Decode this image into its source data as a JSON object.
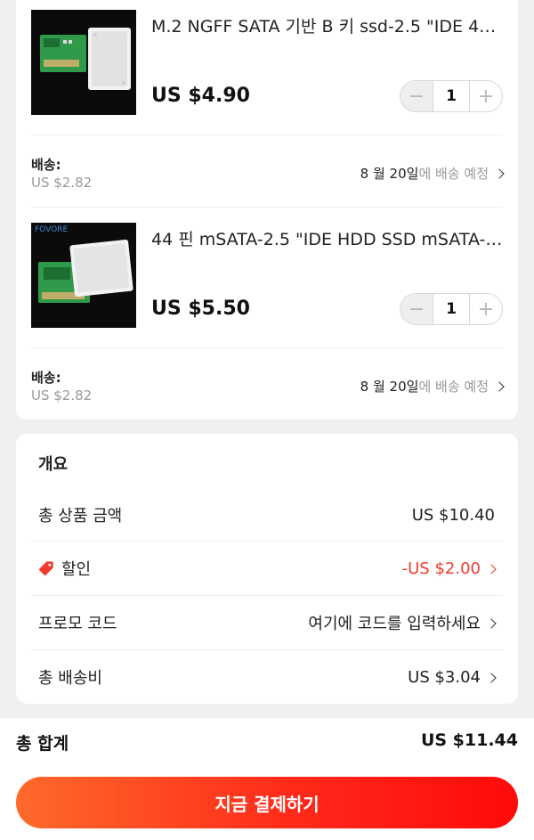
{
  "items": [
    {
      "title": "M.2 NGFF SATA 기반 B 키 ssd-2.5 \"IDE 44...",
      "price": "US $4.90",
      "quantity": "1",
      "shipping_label": "배송:",
      "shipping_cost": "US $2.82",
      "delivery_date": "8 월 20일",
      "delivery_suffix": "에 배송 예정",
      "image_brand": ""
    },
    {
      "title": "44 핀 mSATA-2.5 \"IDE HDD SSD mSATA-P...",
      "price": "US $5.50",
      "quantity": "1",
      "shipping_label": "배송:",
      "shipping_cost": "US $2.82",
      "delivery_date": "8 월 20일",
      "delivery_suffix": "에 배송 예정",
      "image_brand": "FOVORE"
    }
  ],
  "stepper": {
    "minus_icon": "minus-icon",
    "plus_icon": "plus-icon"
  },
  "summary": {
    "title": "개요",
    "rows": [
      {
        "label": "총 상품 금액",
        "value": "US $10.40"
      },
      {
        "label": "할인",
        "value": "-US $2.00",
        "icon": "tag-icon",
        "color": "#f03b2f"
      },
      {
        "label": "프로모 코드",
        "value": "여기에 코드를 입력하세요"
      },
      {
        "label": "총 배송비",
        "value": "US $3.04"
      }
    ]
  },
  "footer": {
    "total_label": "총 합계",
    "total_value": "US $11.44",
    "pay_button": "지금 결제하기"
  },
  "colors": {
    "accent_red": "#f03b2f",
    "button_gradient_start": "#ff6a2a",
    "button_gradient_end": "#ff0a0a",
    "background": "#f0f0f0"
  }
}
